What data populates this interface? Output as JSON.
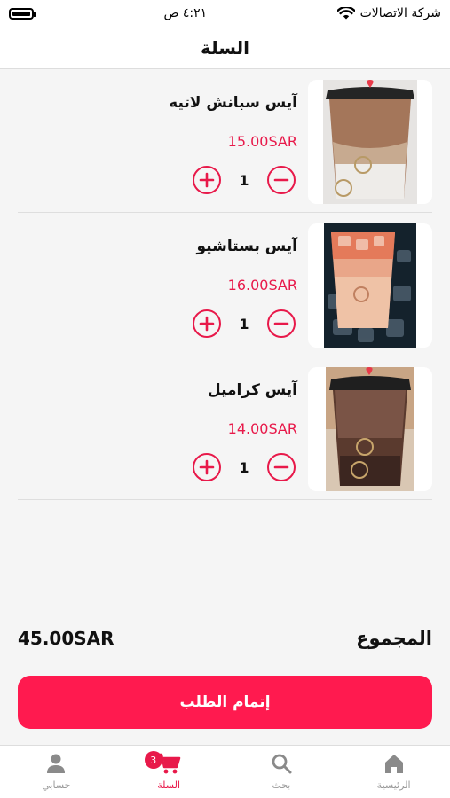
{
  "status_bar": {
    "carrier": "شركة الاتصالات",
    "time": "٤:٢١ ص"
  },
  "header": {
    "title": "السلة"
  },
  "cart": {
    "items": [
      {
        "name": "آيس سبانش لاتيه",
        "price": "15.00SAR",
        "quantity": "1",
        "image_icon": "iced-spanish-latte-image"
      },
      {
        "name": "آيس بستاشيو",
        "price": "16.00SAR",
        "quantity": "1",
        "image_icon": "iced-pistachio-image"
      },
      {
        "name": "آيس كراميل",
        "price": "14.00SAR",
        "quantity": "1",
        "image_icon": "iced-caramel-image"
      }
    ]
  },
  "summary": {
    "total_label": "المجموع",
    "total_value": "45.00SAR"
  },
  "checkout": {
    "label": "إتمام الطلب"
  },
  "tabbar": {
    "items": [
      {
        "label": "حسابي",
        "icon": "person-icon"
      },
      {
        "label": "السلة",
        "icon": "cart-icon",
        "badge": "3"
      },
      {
        "label": "بحث",
        "icon": "search-icon"
      },
      {
        "label": "الرئيسية",
        "icon": "home-icon"
      }
    ]
  },
  "colors": {
    "accent": "#e8194a",
    "button": "#ff1a4f",
    "background": "#f5f5f5"
  }
}
